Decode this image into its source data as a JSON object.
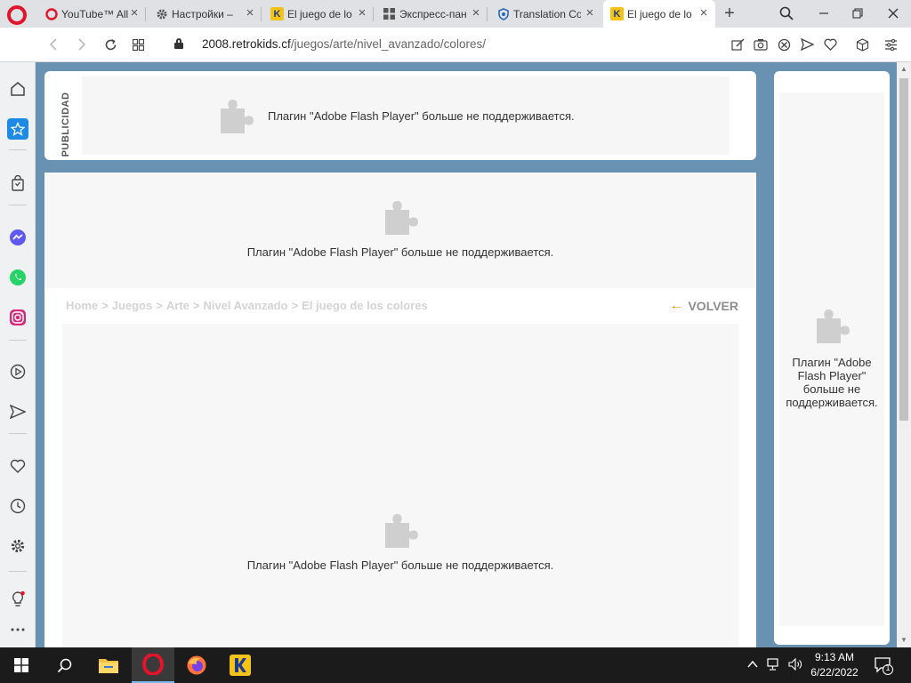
{
  "tabs": [
    {
      "title": "YouTube™ All",
      "icon": "opera-o-icon"
    },
    {
      "title": "Настройки –",
      "icon": "gear-icon"
    },
    {
      "title": "El juego de lo",
      "icon": "retrokids-k-icon"
    },
    {
      "title": "Экспресс-пан",
      "icon": "grid-icon"
    },
    {
      "title": "Translation Co",
      "icon": "translation-shield-icon"
    },
    {
      "title": "El juego de lo",
      "icon": "retrokids-k-icon",
      "active": true
    }
  ],
  "address": {
    "host": "2008.retrokids.cf",
    "path": "/juegos/arte/nivel_avanzado/colores/"
  },
  "page": {
    "publicidad_label": "PUBLICIDAD",
    "plugin_message": "Плагин \"Adobe Flash Player\" больше не поддерживается.",
    "side_plugin_message": "Плагин \"Adobe Flash Player\" больше не поддерживается.",
    "breadcrumb": [
      "Home",
      ">",
      "Juegos",
      ">",
      "Arte",
      ">",
      "Nivel Avanzado",
      ">",
      "El juego de los colores"
    ],
    "back_label": "VOLVER"
  },
  "taskbar": {
    "time": "9:13 AM",
    "date": "6/22/2022",
    "notification_count": "1"
  },
  "colors": {
    "page_bg": "#6991b1",
    "opera_red": "#e3152b",
    "back_arrow": "#e29a23"
  }
}
